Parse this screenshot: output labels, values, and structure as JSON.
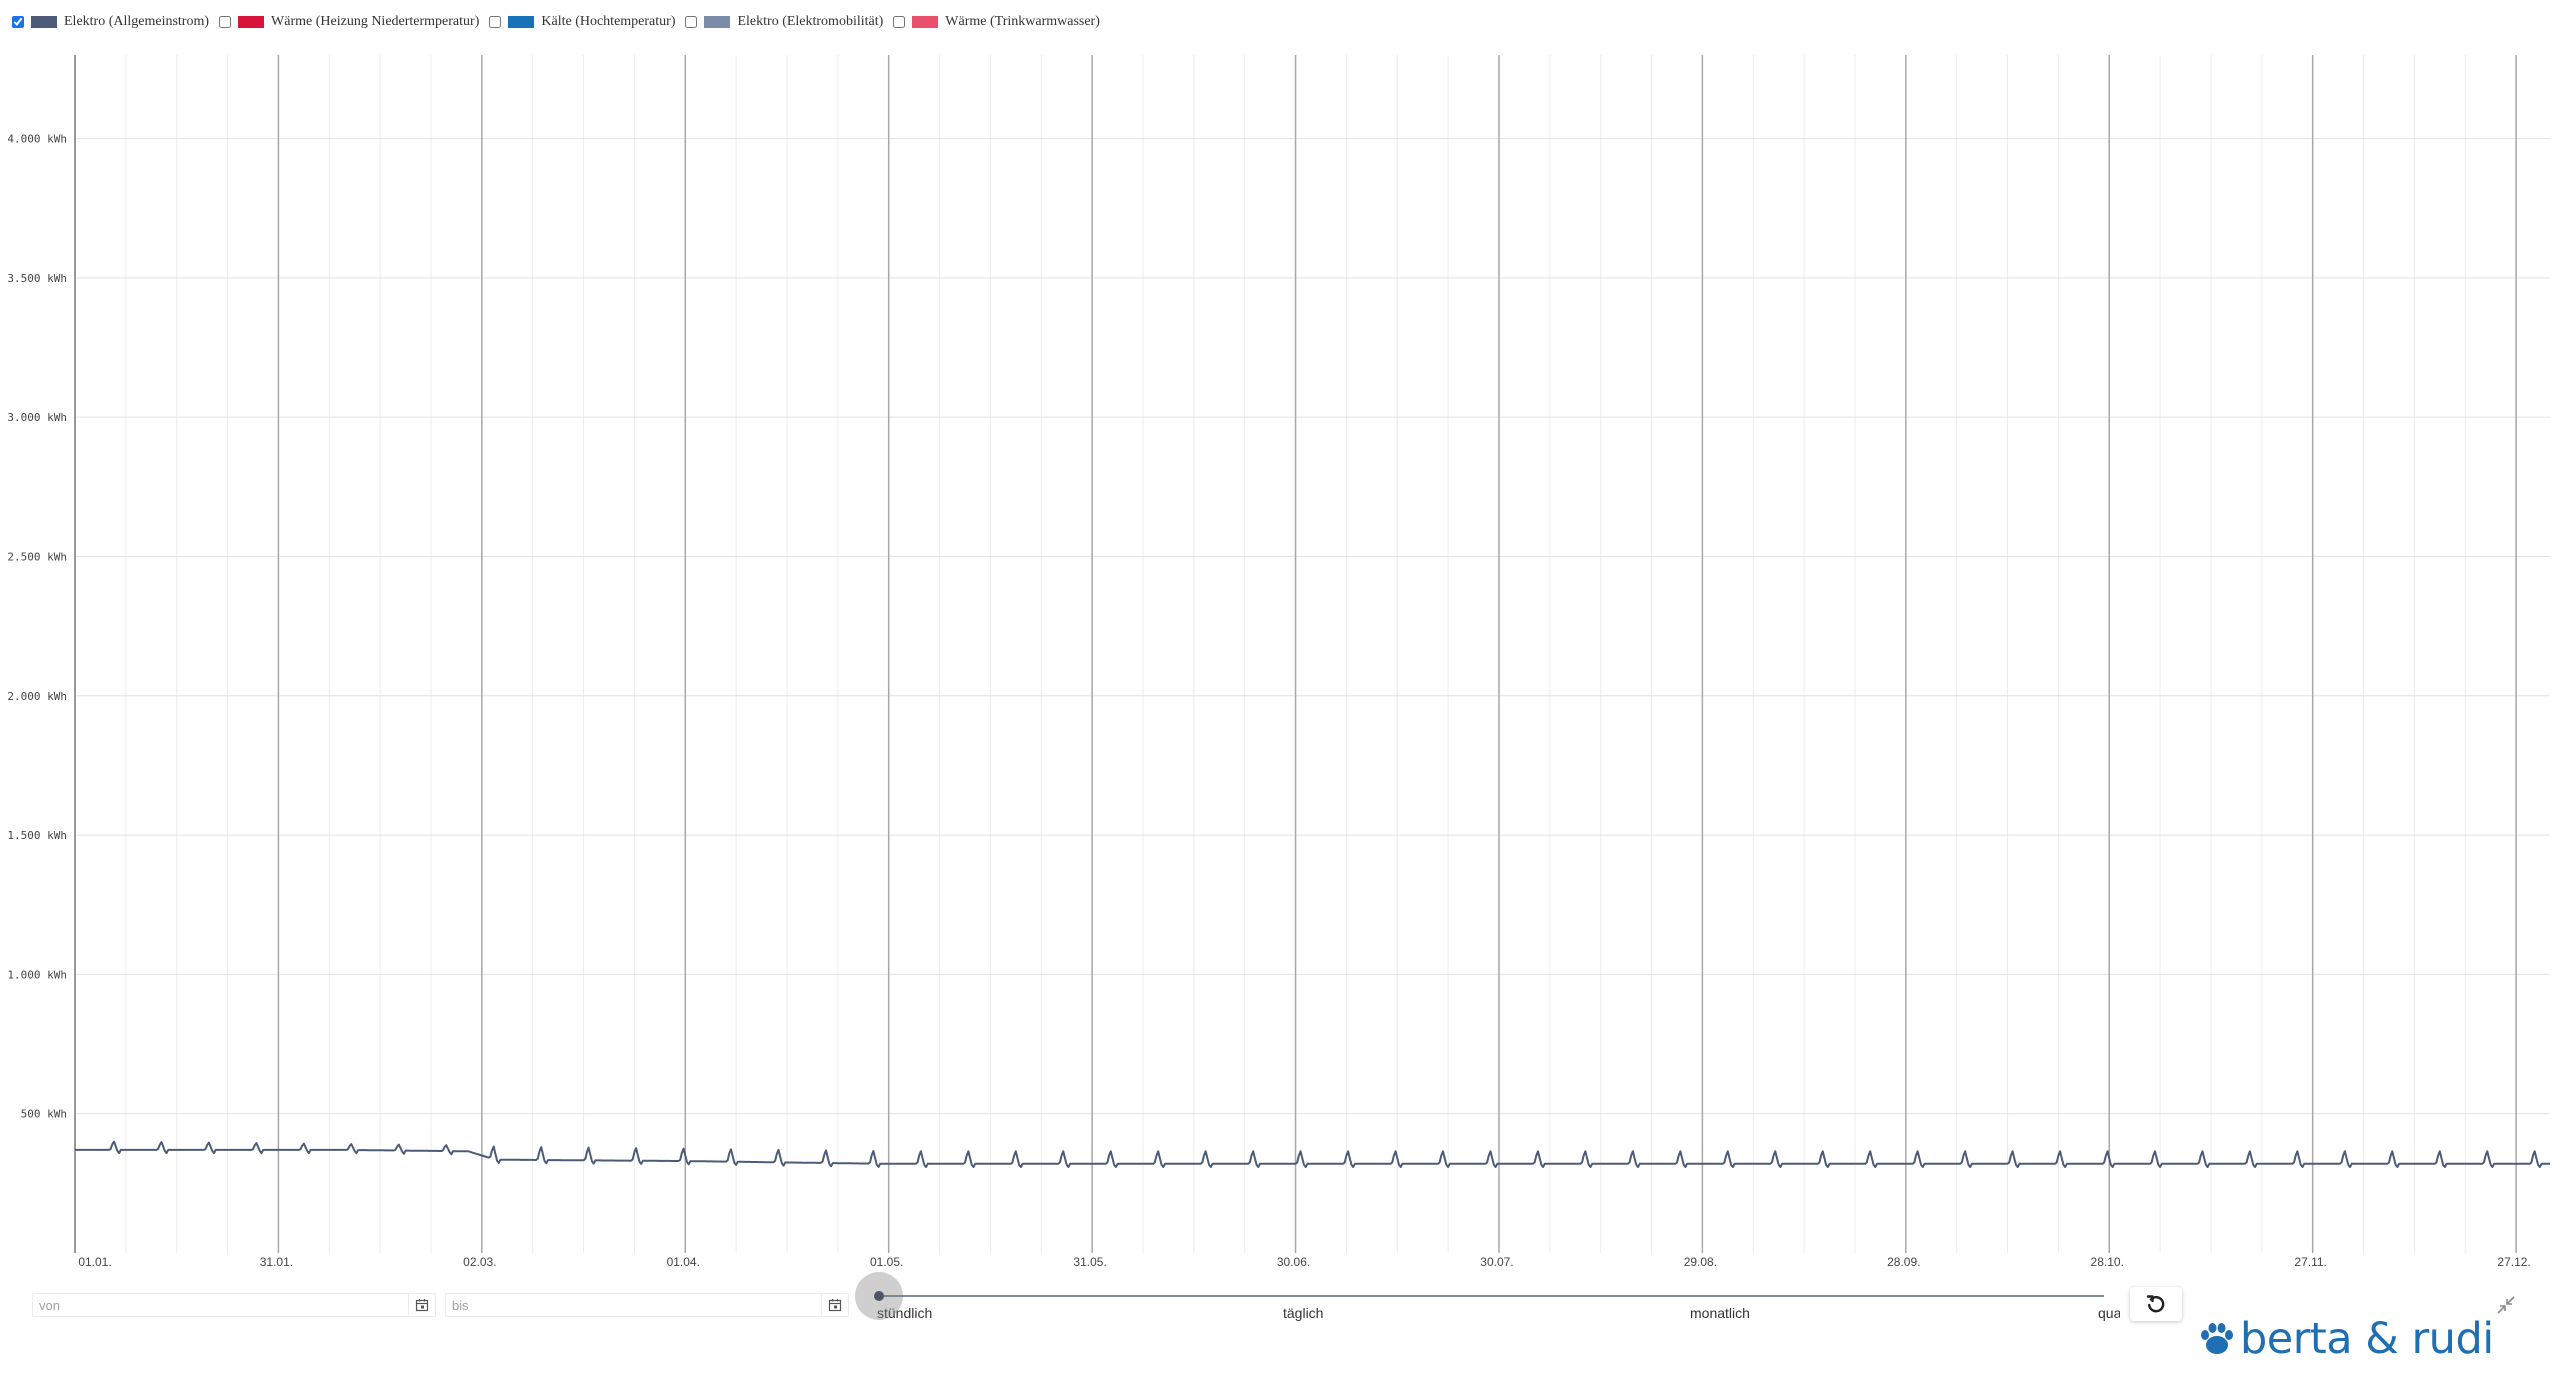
{
  "legend": [
    {
      "label": "Elektro (Allgemeinstrom)",
      "color": "#4d5b78",
      "checked": true
    },
    {
      "label": "Wärme (Heizung Niedertermperatur)",
      "color": "#d9143a",
      "checked": false
    },
    {
      "label": "Kälte (Hochtemperatur)",
      "color": "#1872b8",
      "checked": false
    },
    {
      "label": "Elektro (Elektromobilität)",
      "color": "#7a8ca8",
      "checked": false
    },
    {
      "label": "Wärme (Trinkwarmwasser)",
      "color": "#e8506c",
      "checked": false
    }
  ],
  "chart_data": {
    "type": "line",
    "title": "",
    "xlabel": "",
    "ylabel": "",
    "ylim": [
      0,
      4300
    ],
    "y_ticks": [
      {
        "value": 500,
        "label": "500 kWh"
      },
      {
        "value": 1000,
        "label": "1.000 kWh"
      },
      {
        "value": 1500,
        "label": "1.500 kWh"
      },
      {
        "value": 2000,
        "label": "2.000 kWh"
      },
      {
        "value": 2500,
        "label": "2.500 kWh"
      },
      {
        "value": 3000,
        "label": "3.000 kWh"
      },
      {
        "value": 3500,
        "label": "3.500 kWh"
      },
      {
        "value": 4000,
        "label": "4.000 kWh"
      }
    ],
    "x_range_days": [
      0,
      365
    ],
    "x_ticks": [
      {
        "day": 0,
        "label": "01.01."
      },
      {
        "day": 30,
        "label": "31.01."
      },
      {
        "day": 60,
        "label": "02.03."
      },
      {
        "day": 90,
        "label": "01.04."
      },
      {
        "day": 120,
        "label": "01.05."
      },
      {
        "day": 150,
        "label": "31.05."
      },
      {
        "day": 180,
        "label": "30.06."
      },
      {
        "day": 210,
        "label": "30.07."
      },
      {
        "day": 240,
        "label": "29.08."
      },
      {
        "day": 270,
        "label": "28.09."
      },
      {
        "day": 300,
        "label": "28.10."
      },
      {
        "day": 330,
        "label": "27.11."
      },
      {
        "day": 360,
        "label": "27.12."
      }
    ],
    "grid": true,
    "legend_position": "top-left",
    "series": [
      {
        "name": "Elektro (Allgemeinstrom)",
        "color": "#4d5b78",
        "baseline": [
          [
            0,
            370
          ],
          [
            40,
            370
          ],
          [
            58,
            365
          ],
          [
            62,
            335
          ],
          [
            90,
            330
          ],
          [
            120,
            320
          ],
          [
            365,
            320
          ]
        ],
        "peak_value_start": 405,
        "peak_value_end": 370,
        "peak_interval_days": 7
      }
    ]
  },
  "controls": {
    "from_placeholder": "von",
    "to_placeholder": "bis",
    "resolution_options": [
      "stündlich",
      "täglich",
      "monatlich",
      "quartal"
    ],
    "selected_resolution": "stündlich"
  },
  "icons": {
    "calendar": "calendar-icon",
    "reset": "reset-icon",
    "collapse": "collapse-icon",
    "logo": "paw-icon"
  },
  "logo_text": "berta & rudi"
}
